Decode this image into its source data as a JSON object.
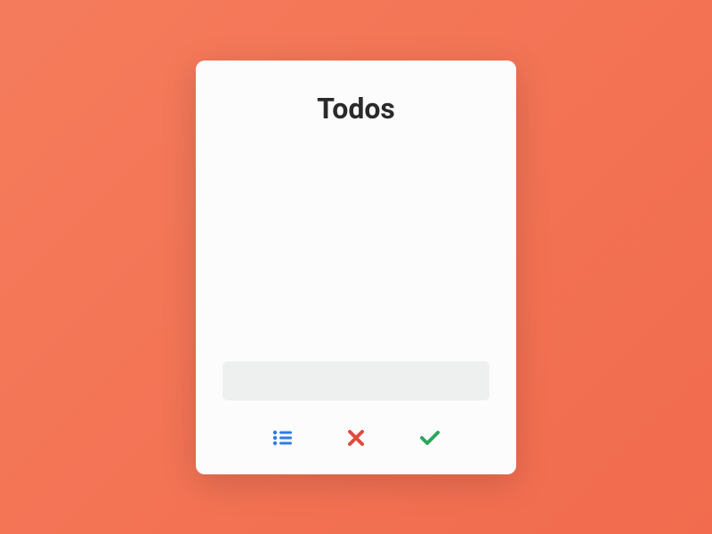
{
  "title": "Todos",
  "input": {
    "value": "",
    "placeholder": ""
  },
  "icons": {
    "list": "list-icon",
    "clear": "x-icon",
    "complete": "check-icon"
  },
  "colors": {
    "background": "#f47c5c",
    "card": "#fcfcfc",
    "input_bg": "#eeefef",
    "list_icon": "#2d7de8",
    "x_icon": "#e24b3a",
    "check_icon": "#29a85c"
  }
}
